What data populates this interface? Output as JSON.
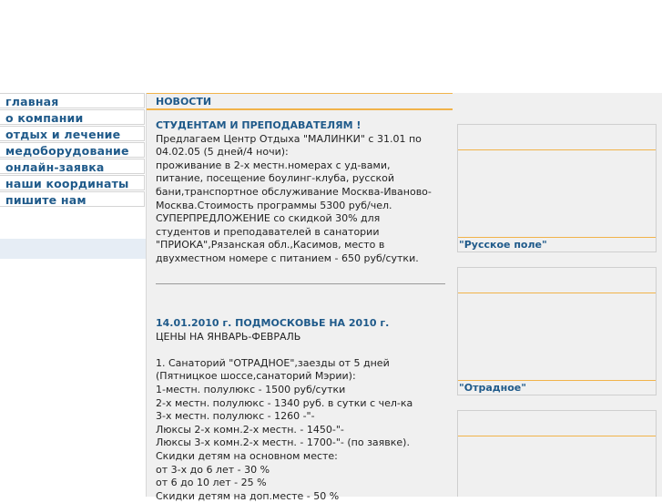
{
  "nav": {
    "items": [
      {
        "label": "главная"
      },
      {
        "label": "о компании"
      },
      {
        "label": "отдых и лечение"
      },
      {
        "label": "медоборудование"
      },
      {
        "label": "онлайн-заявка"
      },
      {
        "label": "наши координаты"
      },
      {
        "label": "пишите нам"
      }
    ]
  },
  "center": {
    "header": "НОВОСТИ",
    "news1": {
      "title": "СТУДЕНТАМ И ПРЕПОДАВАТЕЛЯМ !",
      "lines": [
        "Предлагаем Центр Отдыха \"МАЛИНКИ\"  с 31.01 по",
        "04.02.05 (5 дней/4 ночи):",
        "проживание в  2-х местн.номерах с уд-вами,",
        "питание, посещение боулинг-клуба, русской",
        "бани,транспортное обслуживание Москва-Иваново-",
        "Москва.Стоимость программы 5300 руб/чел.",
        "СУПЕРПРЕДЛОЖЕНИЕ со скидкой  30% для",
        "студентов и преподавателей в санатории",
        "\"ПРИОКА\",Рязанская обл.,Касимов, место в",
        "двухместном номере с питанием - 650 руб/сутки."
      ]
    },
    "news2": {
      "title": "14.01.2010 г. ПОДМОСКОВЬЕ НА 2010 г.",
      "lines": [
        "ЦЕНЫ НА ЯНВАРЬ-ФЕВРАЛЬ",
        "",
        "1. Санаторий \"ОТРАДНОЕ\",заезды от  5 дней",
        "(Пятницкое шоссе,санаторий Мэрии):",
        "1-местн. полулюкс - 1500 руб/сутки",
        "2-х местн. полулюкс - 1340 руб. в сутки с чел-ка",
        "3-х местн. полулюкс - 1260 -\"-",
        "Люксы 2-х комн.2-х местн. - 1450-\"-",
        "Люксы 3-х комн.2-х местн. - 1700-\"- (по заявке).",
        "Скидки детям на основном месте:",
        "от 3-х до 6 лет - 30 %",
        "от 6 до 10 лет - 25 %",
        "Скидки детям на доп.месте - 50 %"
      ]
    }
  },
  "right": {
    "promos": [
      {
        "caption": "\"Русское поле\""
      },
      {
        "caption": "\"Отрадное\""
      },
      {
        "caption": ""
      }
    ]
  },
  "colors": {
    "accent_orange": "#f1b34a",
    "link_blue": "#1f5a8a",
    "panel_gray": "#f0f0f0"
  }
}
